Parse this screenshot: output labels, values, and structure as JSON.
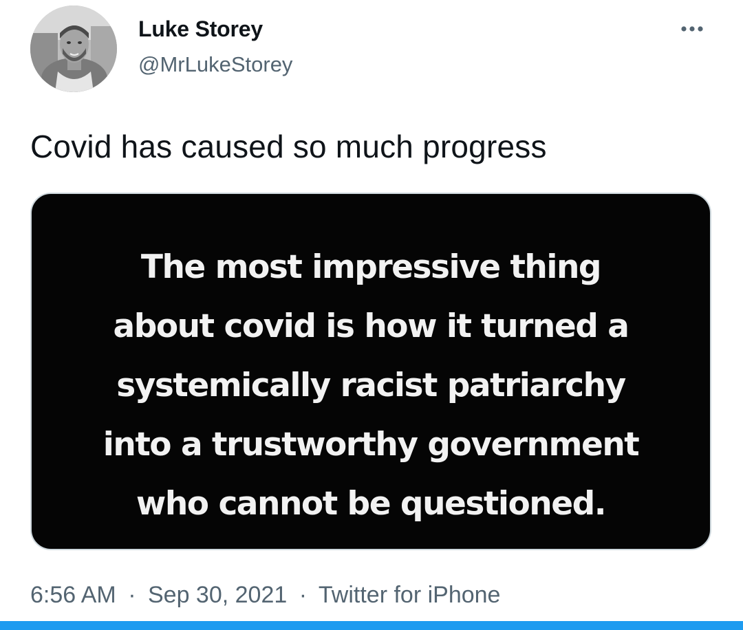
{
  "tweet": {
    "author": {
      "display_name": "Luke Storey",
      "handle": "@MrLukeStorey"
    },
    "text": "Covid has caused so much progress",
    "media": {
      "lines": [
        "The most impressive thing",
        "about covid is how it turned a",
        "systemically racist patriarchy",
        "into a trustworthy government",
        "who cannot be questioned."
      ]
    },
    "meta": {
      "time": "6:56 AM",
      "separator": "·",
      "date": "Sep 30, 2021",
      "source": "Twitter for iPhone"
    }
  },
  "colors": {
    "text": "#0f1419",
    "secondary": "#536471",
    "accent": "#1d9bf0",
    "media_background": "#050505"
  },
  "icons": {
    "more": "more-horizontal-icon"
  }
}
